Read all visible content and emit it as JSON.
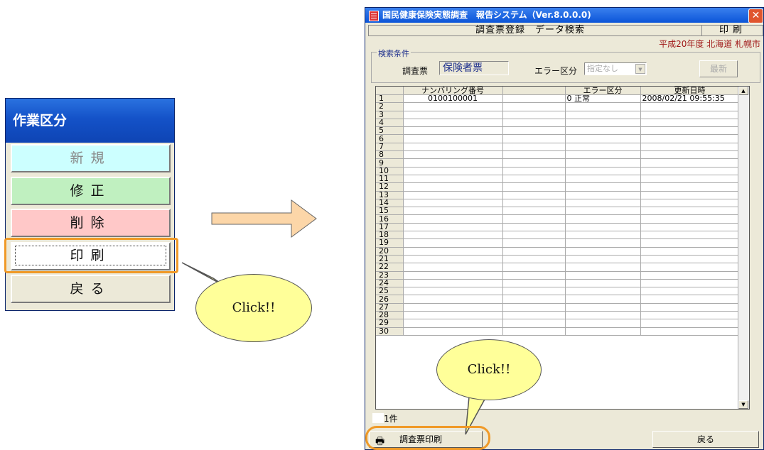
{
  "left_panel": {
    "title": "作業区分",
    "buttons": {
      "new": "新規",
      "edit": "修正",
      "delete": "削除",
      "print": "印刷",
      "back": "戻る"
    }
  },
  "callouts": {
    "left": "Click!!",
    "bottom": "Click!!"
  },
  "window": {
    "title": "国民健康保険実態調査　報告システム（Ver.8.0.0.0)",
    "screen_title": "調査票登録　データ検索",
    "screen_mode": "印刷",
    "locale": "平成20年度  北海道  札幌市",
    "search": {
      "legend": "検索条件",
      "form_label": "調査票",
      "form_value": "保険者票",
      "error_label": "エラー区分",
      "error_value": "指定なし",
      "refresh_label": "最新"
    },
    "table": {
      "columns": [
        "",
        "ナンバリング番号",
        "",
        "エラー区分",
        "更新日時"
      ],
      "rows": [
        [
          "1",
          "0100100001",
          "",
          "0 正常",
          "2008/02/21 09:55:35"
        ],
        [
          "2",
          "",
          "",
          "",
          ""
        ],
        [
          "3",
          "",
          "",
          "",
          ""
        ],
        [
          "4",
          "",
          "",
          "",
          ""
        ],
        [
          "5",
          "",
          "",
          "",
          ""
        ],
        [
          "6",
          "",
          "",
          "",
          ""
        ],
        [
          "7",
          "",
          "",
          "",
          ""
        ],
        [
          "8",
          "",
          "",
          "",
          ""
        ],
        [
          "9",
          "",
          "",
          "",
          ""
        ],
        [
          "10",
          "",
          "",
          "",
          ""
        ],
        [
          "11",
          "",
          "",
          "",
          ""
        ],
        [
          "12",
          "",
          "",
          "",
          ""
        ],
        [
          "13",
          "",
          "",
          "",
          ""
        ],
        [
          "14",
          "",
          "",
          "",
          ""
        ],
        [
          "15",
          "",
          "",
          "",
          ""
        ],
        [
          "16",
          "",
          "",
          "",
          ""
        ],
        [
          "17",
          "",
          "",
          "",
          ""
        ],
        [
          "18",
          "",
          "",
          "",
          ""
        ],
        [
          "19",
          "",
          "",
          "",
          ""
        ],
        [
          "20",
          "",
          "",
          "",
          ""
        ],
        [
          "21",
          "",
          "",
          "",
          ""
        ],
        [
          "22",
          "",
          "",
          "",
          ""
        ],
        [
          "23",
          "",
          "",
          "",
          ""
        ],
        [
          "24",
          "",
          "",
          "",
          ""
        ],
        [
          "25",
          "",
          "",
          "",
          ""
        ],
        [
          "26",
          "",
          "",
          "",
          ""
        ],
        [
          "27",
          "",
          "",
          "",
          ""
        ],
        [
          "28",
          "",
          "",
          "",
          ""
        ],
        [
          "29",
          "",
          "",
          "",
          ""
        ],
        [
          "30",
          "",
          "",
          "",
          ""
        ]
      ]
    },
    "count": "1件",
    "print_button": "調査票印刷",
    "back_button": "戻る"
  },
  "colors": {
    "highlight": "#f09a28",
    "callout": "#ffff99",
    "arrow": "#fcd6a8",
    "title_bar": "#0b55d8"
  },
  "icons": [
    "close-icon",
    "app-icon",
    "printer-icon",
    "dropdown-arrow-icon",
    "scroll-up-icon",
    "scroll-down-icon",
    "right-arrow-icon"
  ]
}
